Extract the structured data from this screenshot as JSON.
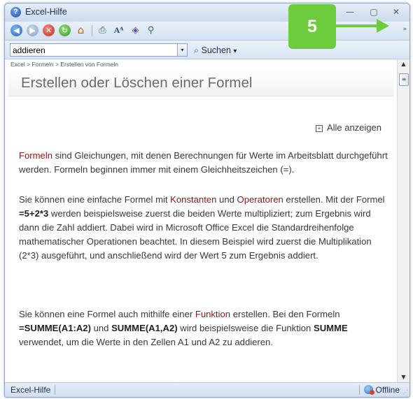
{
  "window": {
    "title": "Excel-Hilfe",
    "controls": {
      "minimize": "—",
      "maximize": "▢",
      "close": "✕"
    }
  },
  "toolbar": {
    "icons": [
      "back-icon",
      "forward-icon",
      "stop-icon",
      "refresh-icon",
      "home-icon",
      "print-icon",
      "text-size-icon",
      "toc-icon",
      "pin-icon"
    ],
    "overflow": "»"
  },
  "search": {
    "value": "addieren",
    "button_label": "Suchen",
    "button_arrow": "▾",
    "dropdown_arrow": "▾"
  },
  "content": {
    "breadcrumb": "Excel > Formeln > Erstellen von Formeln",
    "title": "Erstellen oder Löschen einer Formel",
    "show_all": "Alle anzeigen",
    "p1": {
      "link": "Formeln",
      "text": " sind Gleichungen, mit denen Berechnungen für Werte im Arbeitsblatt durchgeführt werden. Formeln beginnen immer mit einem Gleichheitszeichen (=)."
    },
    "p2": {
      "t1": "Sie können eine einfache Formel mit ",
      "link1": "Konstanten",
      "t2": " und ",
      "link2": "Operatoren",
      "t3": " erstellen. Mit der Formel ",
      "bold1": "=5+2*3",
      "t4": " werden beispielsweise zuerst die beiden Werte multipliziert; zum Ergebnis wird dann die Zahl addiert. Dabei wird in Microsoft Office Excel die Standardreihenfolge mathematischer Operationen beachtet. In diesem Beispiel wird zuerst die Multiplikation (2*3) ausgeführt, und anschließend wird der Wert 5 zum Ergebnis addiert."
    },
    "p3": {
      "t1": "Sie können eine Formel auch mithilfe einer ",
      "link1": "Funktion",
      "t2": " erstellen. Bei den Formeln ",
      "bold1": "=SUMME(A1:A2)",
      "t3": " und ",
      "bold2": "SUMME(A1,A2)",
      "t4": " wird beispielsweise die Funktion ",
      "bold3": "SUMME",
      "t5": " verwendet, um die Werte in den Zellen A1 und A2 zu addieren."
    }
  },
  "status": {
    "left": "Excel-Hilfe",
    "right": "Offline"
  },
  "callout": {
    "number": "5",
    "color": "#6ccc3e"
  }
}
